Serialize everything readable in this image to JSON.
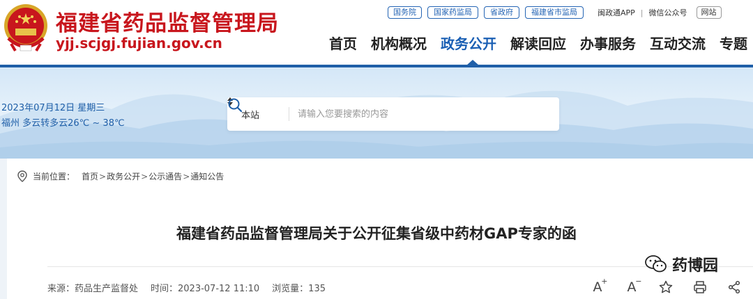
{
  "header": {
    "site_title": "福建省药品监督管理局",
    "site_domain": "yjj.scjgj.fujian.gov.cn",
    "top_links": [
      "国务院",
      "国家药监局",
      "省政府",
      "福建省市监局"
    ],
    "app_label": "闽政通APP",
    "separator": "|",
    "wechat_label": "微信公众号",
    "weibo_label": "网站"
  },
  "nav": {
    "items": [
      "首页",
      "机构概况",
      "政务公开",
      "解读回应",
      "办事服务",
      "互动交流",
      "专题"
    ],
    "active": "政务公开"
  },
  "banner": {
    "date": "2023年07月12日 星期三",
    "weather": "福州 多云转多云26℃ ~ 38℃"
  },
  "search": {
    "scope": "本站",
    "placeholder": "请输入您要搜索的内容"
  },
  "breadcrumb": {
    "label": "当前位置：",
    "items": [
      "首页",
      "政务公开",
      "公示通告",
      "通知公告"
    ],
    "separator": ">"
  },
  "article": {
    "title": "福建省药品监督管理局关于公开征集省级中药材GAP专家的函",
    "source": "来源：药品生产监督处",
    "time": "时间：2023-07-12 11:10",
    "views": "浏览量：135"
  },
  "tools": {
    "font_larger": "A",
    "font_smaller": "A"
  },
  "watermark": {
    "text": "药博园"
  },
  "colors": {
    "brand_red": "#c8161d",
    "nav_blue": "#1f5fa8",
    "link_blue": "#2464b4"
  }
}
